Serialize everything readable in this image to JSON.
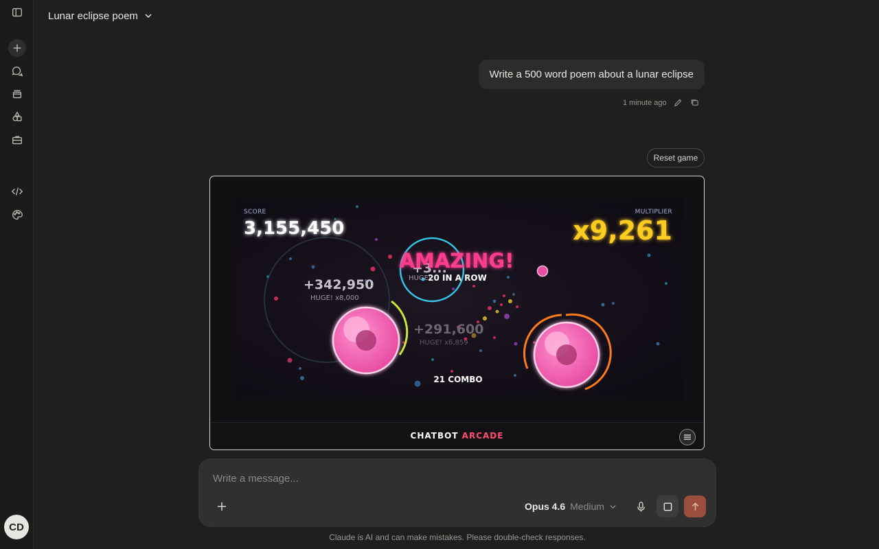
{
  "sidebar": {
    "avatar_initials": "CD",
    "items": [
      {
        "name": "sidebar-toggle-icon"
      },
      {
        "name": "new-chat-icon"
      },
      {
        "name": "chats-icon"
      },
      {
        "name": "projects-icon"
      },
      {
        "name": "artifacts-icon"
      },
      {
        "name": "briefcase-icon"
      },
      {
        "name": "code-icon"
      },
      {
        "name": "palette-icon"
      }
    ]
  },
  "header": {
    "title": "Lunar eclipse poem"
  },
  "message": {
    "text": "Write a 500 word poem about a lunar eclipse",
    "timestamp": "1 minute ago"
  },
  "artifact": {
    "reset_label": "Reset game",
    "game": {
      "score_label": "SCORE",
      "score_value": "3,155,450",
      "multiplier_label": "MULTIPLIER",
      "multiplier_value": "x9,261",
      "amazing_text": "AMAZING!",
      "overlap_text": "+3...",
      "row_text": "20 IN A ROW",
      "combo_text": "21 COMBO",
      "floats": [
        {
          "value": "+342,950",
          "sub": "HUGE! x8,000"
        },
        {
          "value": "+291,600",
          "sub": "HUGE! x6,859"
        },
        {
          "sub": "HUGE!"
        }
      ],
      "colors": {
        "pink": "#ff5cb0",
        "gold": "#ffcc22",
        "cyan": "#35c3e6",
        "orange": "#ff7a1a",
        "lime": "#c8e830"
      }
    },
    "brand_part1": "CHATBOT",
    "brand_part2": "ARCADE"
  },
  "composer": {
    "placeholder": "Write a message...",
    "model": "Opus 4.6",
    "effort": "Medium"
  },
  "disclaimer": "Claude is AI and can make mistakes. Please double-check responses."
}
